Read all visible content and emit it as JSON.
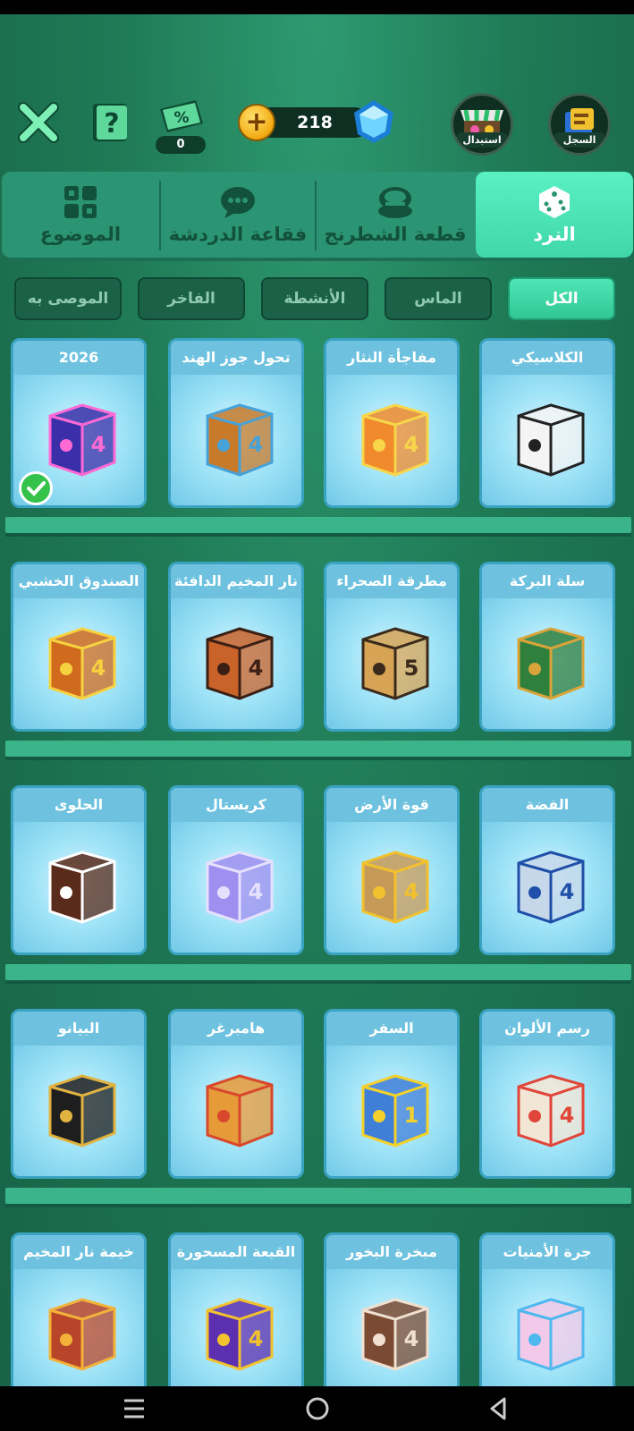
{
  "header": {
    "coupon_count": "0",
    "coin_count": "218",
    "exchange_label": "استبدال",
    "record_label": "السجل"
  },
  "tabs": [
    {
      "label": "النرد",
      "icon": "dice-icon",
      "active": true
    },
    {
      "label": "قطعة الشطرنج",
      "icon": "chess-piece-icon",
      "active": false
    },
    {
      "label": "فقاعة الدردشة",
      "icon": "chat-bubble-icon",
      "active": false
    },
    {
      "label": "الموضوع",
      "icon": "theme-grid-icon",
      "active": false
    }
  ],
  "filters": [
    {
      "label": "الكل",
      "active": true
    },
    {
      "label": "الماس",
      "active": false
    },
    {
      "label": "الأنشطة",
      "active": false
    },
    {
      "label": "الفاخر",
      "active": false
    },
    {
      "label": "الموصى به",
      "active": false
    }
  ],
  "items": [
    {
      "title": "الكلاسيكي",
      "color": "#f4f4f4",
      "accent": "#222222",
      "digit": "",
      "selected": false
    },
    {
      "title": "مفاجأة النثار",
      "color": "#f08a2c",
      "accent": "#f7d64a",
      "digit": "4",
      "selected": false
    },
    {
      "title": "تحول جوز الهند",
      "color": "#c77a2a",
      "accent": "#47a2d8",
      "digit": "4",
      "selected": false
    },
    {
      "title": "2026",
      "color": "#3a2fa8",
      "accent": "#ff6ad5",
      "digit": "4",
      "selected": true
    },
    {
      "title": "سلة البركة",
      "color": "#2f7f3d",
      "accent": "#d9a43a",
      "digit": "",
      "selected": false
    },
    {
      "title": "مطرقة الصحراء",
      "color": "#d7a456",
      "accent": "#3a2a1c",
      "digit": "5",
      "selected": false
    },
    {
      "title": "نار المخيم الدافئة",
      "color": "#c9632a",
      "accent": "#3b1f14",
      "digit": "4",
      "selected": false
    },
    {
      "title": "الصندوق الخشبي",
      "color": "#d06b1e",
      "accent": "#f7d240",
      "digit": "4",
      "selected": false
    },
    {
      "title": "الفضة",
      "color": "#c6d7ea",
      "accent": "#1f4fa8",
      "digit": "4",
      "selected": false
    },
    {
      "title": "قوة الأرض",
      "color": "#c59a58",
      "accent": "#f2c12e",
      "digit": "4",
      "selected": false
    },
    {
      "title": "كريستال",
      "color": "#9f8ff0",
      "accent": "#e6e0ff",
      "digit": "4",
      "selected": false
    },
    {
      "title": "الحلوى",
      "color": "#5a2a1a",
      "accent": "#ffffff",
      "digit": "",
      "selected": false
    },
    {
      "title": "رسم الألوان",
      "color": "#f2e6d6",
      "accent": "#e0463a",
      "digit": "4",
      "selected": false
    },
    {
      "title": "السفر",
      "color": "#3f7fd8",
      "accent": "#f4d12a",
      "digit": "1",
      "selected": false
    },
    {
      "title": "هامبرغر",
      "color": "#e69a38",
      "accent": "#d9482c",
      "digit": "",
      "selected": false
    },
    {
      "title": "البيانو",
      "color": "#1e1e1e",
      "accent": "#e0b341",
      "digit": "",
      "selected": false
    },
    {
      "title": "جرة الأمنيات",
      "color": "#f2c9e8",
      "accent": "#4fb8ee",
      "digit": "",
      "selected": false
    },
    {
      "title": "مبخرة البخور",
      "color": "#7a4a32",
      "accent": "#f0e0d0",
      "digit": "4",
      "selected": false
    },
    {
      "title": "القبعة المسحورة",
      "color": "#5b2fb0",
      "accent": "#f2c12e",
      "digit": "4",
      "selected": false
    },
    {
      "title": "خيمة نار المخيم",
      "color": "#b8452a",
      "accent": "#f2b23a",
      "digit": "",
      "selected": false
    }
  ]
}
